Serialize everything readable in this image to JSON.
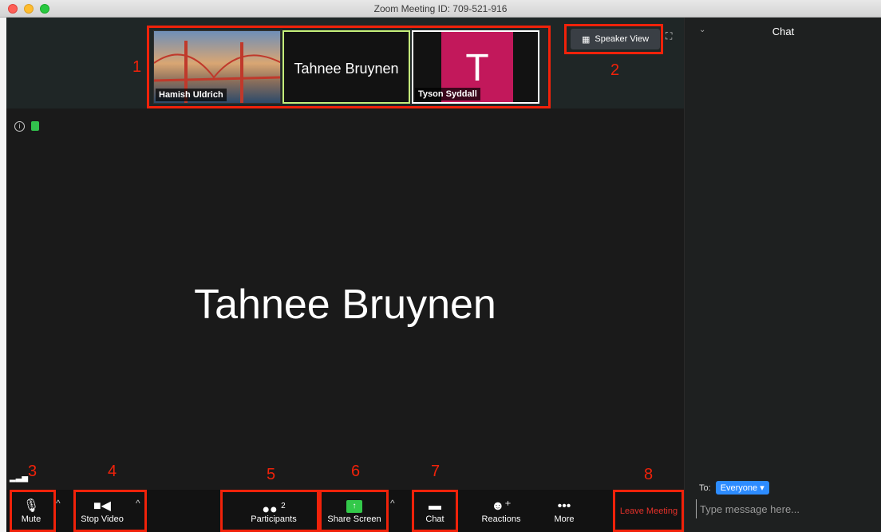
{
  "window": {
    "title": "Zoom Meeting ID: 709-521-916"
  },
  "thumbnails": [
    {
      "name": "Hamish Uldrich"
    },
    {
      "name": "Tahnee Bruynen"
    },
    {
      "name": "Tyson Syddall",
      "initial": "T"
    }
  ],
  "speaker_view": {
    "label": "Speaker View"
  },
  "main": {
    "speaker_name": "Tahnee Bruynen"
  },
  "annotations": [
    "1",
    "2",
    "3",
    "4",
    "5",
    "6",
    "7",
    "8"
  ],
  "toolbar": {
    "mute": "Mute",
    "stop_video": "Stop Video",
    "participants": "Participants",
    "participants_count": "2",
    "share_screen": "Share Screen",
    "chat": "Chat",
    "reactions": "Reactions",
    "more": "More",
    "leave": "Leave Meeting"
  },
  "chat": {
    "title": "Chat",
    "to_label": "To:",
    "to_value": "Everyone",
    "placeholder": "Type message here..."
  },
  "colors": {
    "accent": "#2d8cff",
    "leave": "#e7312a",
    "annotation": "#f0220a",
    "share": "#33c94a",
    "avatar": "#c2185b"
  }
}
